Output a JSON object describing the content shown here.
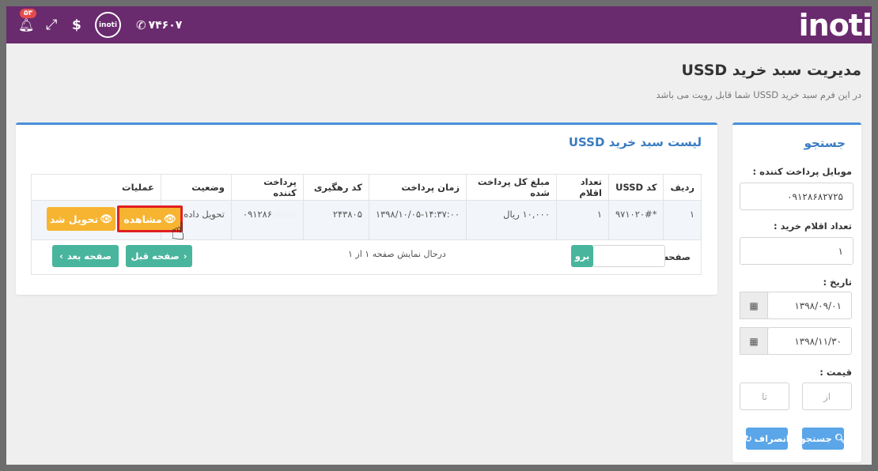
{
  "topbar": {
    "logo": "inoti",
    "phone": "۷۴۶۰۷",
    "circle_logo": "inoti",
    "dollar": "$",
    "notification_count": "۵۳",
    "colors": {
      "bar": "#6a2a6e"
    }
  },
  "header": {
    "title": "مدیریت سبد خرید USSD",
    "subtitle": "در این فرم سبد خرید USSD شما قابل رویت می باشد"
  },
  "search": {
    "title": "جستجو",
    "mobile_label": "موبایل پرداخت کننده :",
    "mobile_value": "۰۹۱۲۸۶۸۲۷۲۵",
    "items_label": "تعداد اقلام خرید :",
    "items_value": "۱",
    "date_label": "تاریخ :",
    "date_from": "۱۳۹۸/۰۹/۰۱",
    "date_to": "۱۳۹۸/۱۱/۳۰",
    "price_label": "قیمت :",
    "price_from_placeholder": "از",
    "price_to_placeholder": "تا",
    "search_button": "جستجو",
    "cancel_button": "انصراف"
  },
  "list": {
    "title": "لیست سبد خرید USSD",
    "columns": [
      "ردیف",
      "کد USSD",
      "تعداد اقلام",
      "مبلغ کل پرداخت شده",
      "زمان پرداخت",
      "کد رهگیری",
      "پرداخت کننده",
      "وضعیت",
      "عملیات"
    ],
    "rows": [
      {
        "row": "۱",
        "ussd": "*۹۷۱۰۲۰#",
        "count": "۱",
        "amount": "۱۰,۰۰۰ ریال",
        "time": "۱۳۹۸/۱۰/۰۵-۱۴:۳۷:۰۰",
        "tracking": "۲۴۳۸۰۵",
        "payer": "۰۹۱۲۸۶",
        "status": "تحویل داده شد",
        "view_button": "مشاهده",
        "deliver_button": "تحویل شد"
      }
    ],
    "pager": {
      "page_label": "صفحه :",
      "go_button": "برو",
      "info": "درحال نمایش صفحه ۱ از ۱",
      "prev_button": "صفحه قبل",
      "next_button": "صفحه بعد"
    }
  }
}
